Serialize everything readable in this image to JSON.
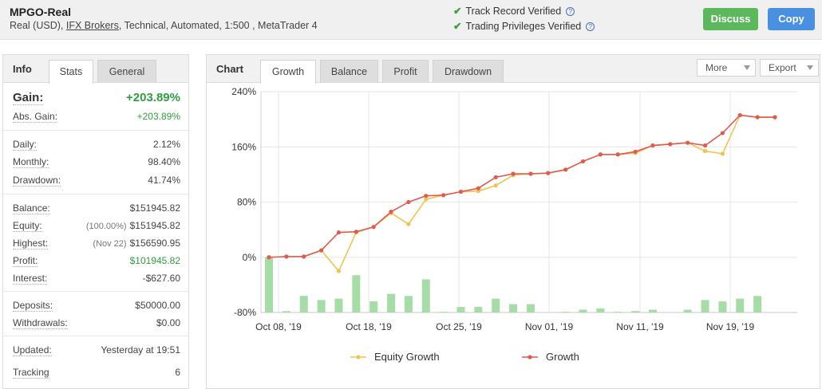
{
  "header": {
    "account_name": "MPGO-Real",
    "sub_prefix": "Real (USD),",
    "broker_link": "IFX Brokers",
    "sub_suffix": ", Technical, Automated, 1:500 , MetaTrader 4",
    "verifications": [
      "Track Record Verified",
      "Trading Privileges Verified"
    ],
    "discuss_label": "Discuss",
    "copy_label": "Copy"
  },
  "info_panel": {
    "title": "Info",
    "tabs": [
      "Stats",
      "General"
    ],
    "gain": {
      "label": "Gain:",
      "value": "+203.89%"
    },
    "abs_gain": {
      "label": "Abs. Gain:",
      "value": "+203.89%"
    },
    "daily": {
      "label": "Daily:",
      "value": "2.12%"
    },
    "monthly": {
      "label": "Monthly:",
      "value": "98.40%"
    },
    "drawdown": {
      "label": "Drawdown:",
      "value": "41.74%"
    },
    "balance": {
      "label": "Balance:",
      "value": "$151945.82"
    },
    "equity": {
      "label": "Equity:",
      "pre": "(100.00%)",
      "value": "$151945.82"
    },
    "highest": {
      "label": "Highest:",
      "pre": "(Nov 22)",
      "value": "$156590.95"
    },
    "profit": {
      "label": "Profit:",
      "value": "$101945.82"
    },
    "interest": {
      "label": "Interest:",
      "value": "-$627.60"
    },
    "deposits": {
      "label": "Deposits:",
      "value": "$50000.00"
    },
    "withdrawals": {
      "label": "Withdrawals:",
      "value": "$0.00"
    },
    "updated": {
      "label": "Updated:",
      "value": "Yesterday at 19:51"
    },
    "tracking": {
      "label": "Tracking",
      "value": "6"
    }
  },
  "chart_panel": {
    "title": "Chart",
    "tabs": [
      "Growth",
      "Balance",
      "Profit",
      "Drawdown"
    ],
    "more_label": "More",
    "export_label": "Export"
  },
  "colors": {
    "growth": "#e05a4f",
    "equity": "#efc44f",
    "bars": "#a6dca6",
    "gain_green": "#2e9e3e",
    "discuss": "#5cb85c",
    "copy": "#4a90e2"
  },
  "chart_data": {
    "type": "line",
    "ylim": [
      -80,
      240
    ],
    "yticks": [
      "240%",
      "160%",
      "80%",
      "0%",
      "-80%"
    ],
    "xticks": [
      "Oct 08, '19",
      "Oct 18, '19",
      "Oct 25, '19",
      "Nov 01, '19",
      "Nov 11, '19",
      "Nov 19, '19"
    ],
    "grid": true,
    "legend_position": "bottom",
    "series": [
      {
        "name": "Equity Growth",
        "values": [
          0,
          1,
          1,
          10,
          -20,
          36,
          44,
          64,
          48,
          84,
          90,
          95,
          96,
          104,
          119,
          121,
          122,
          127,
          139,
          149,
          149,
          151,
          162,
          164,
          166,
          154,
          150,
          206,
          203,
          203
        ]
      },
      {
        "name": "Growth",
        "values": [
          0,
          1,
          1,
          10,
          36,
          37,
          44,
          66,
          80,
          89,
          90,
          95,
          100,
          116,
          121,
          121,
          122,
          127,
          139,
          149,
          149,
          153,
          162,
          164,
          166,
          162,
          180,
          206,
          203,
          203
        ]
      }
    ],
    "bars": {
      "values": [
        0,
        -78,
        -56,
        -62,
        -60,
        -26,
        -64,
        -53,
        -56,
        -32,
        -79,
        -72,
        -72,
        -60,
        -68,
        -68,
        -80,
        -79,
        -76,
        -74,
        -79,
        -78,
        -76,
        -80,
        -76,
        -62,
        -64,
        -60,
        -56,
        -80
      ]
    }
  }
}
